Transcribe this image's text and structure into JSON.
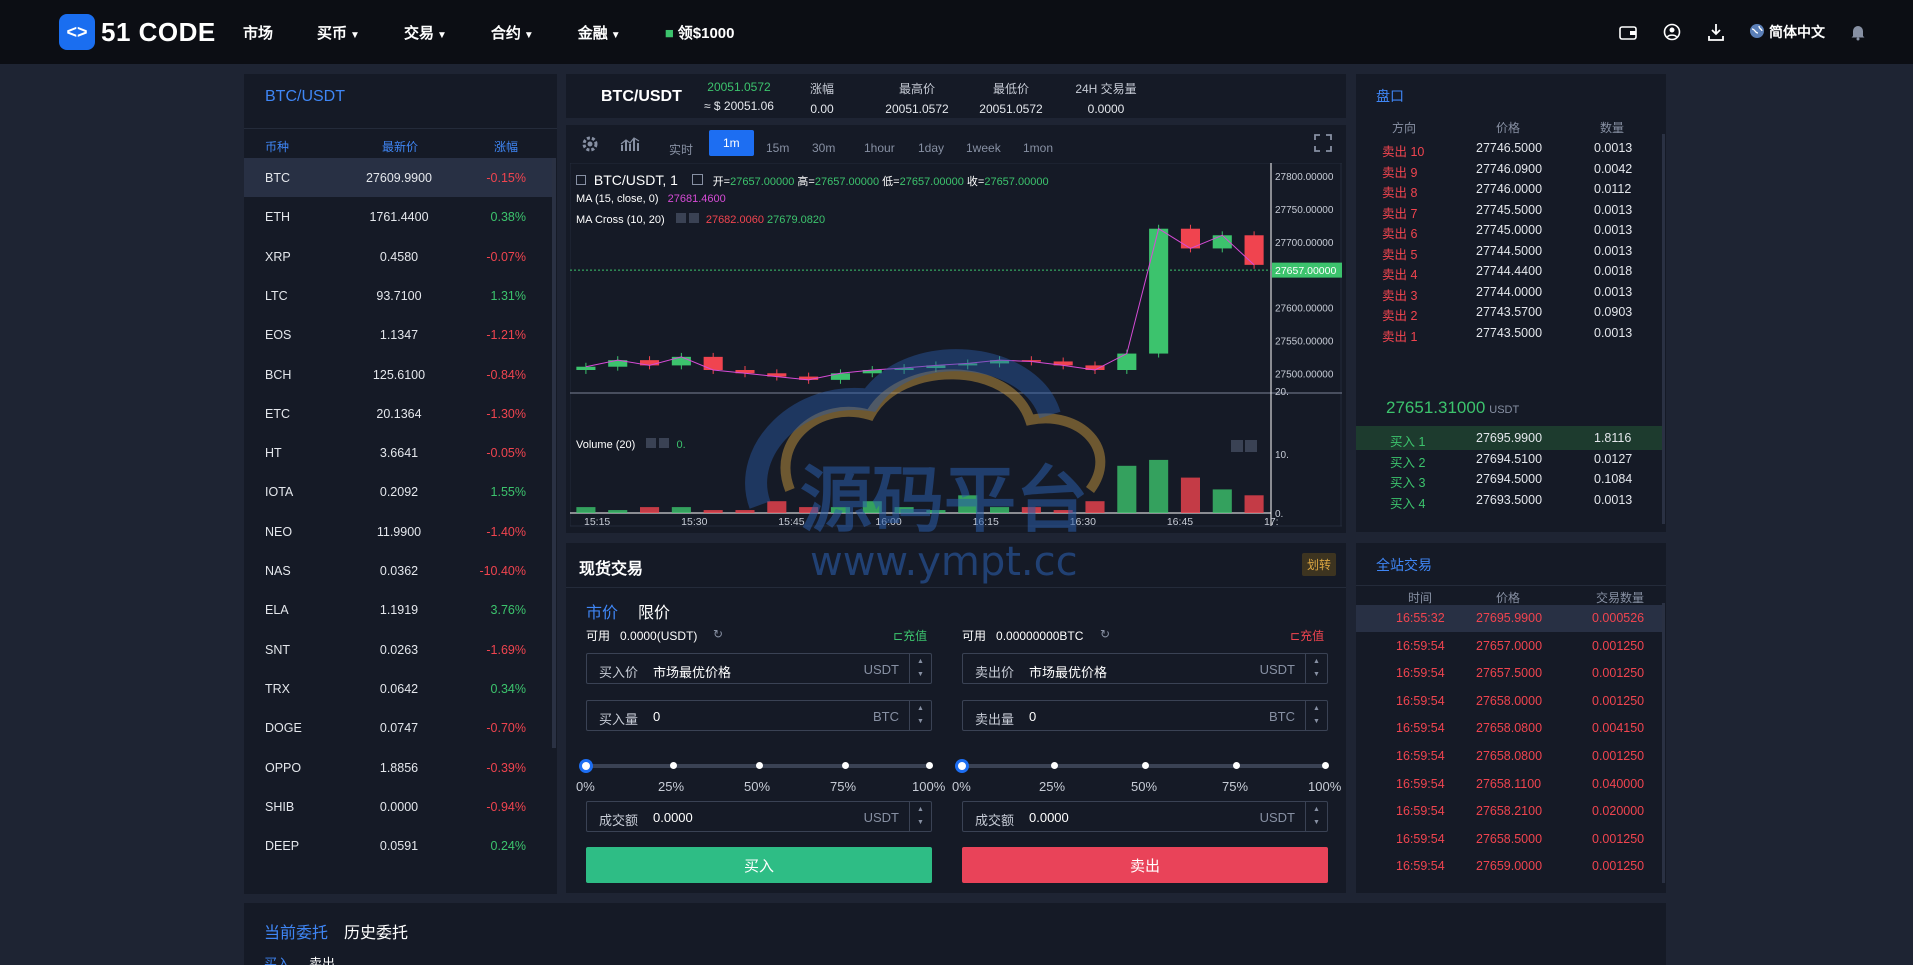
{
  "brand": {
    "logo_glyph": "<>",
    "name": "51 CODE"
  },
  "nav": [
    {
      "label": "市场",
      "dropdown": false
    },
    {
      "label": "买币",
      "dropdown": true
    },
    {
      "label": "交易",
      "dropdown": true
    },
    {
      "label": "合约",
      "dropdown": true
    },
    {
      "label": "金融",
      "dropdown": true
    },
    {
      "label": "领$1000",
      "dropdown": false
    }
  ],
  "top_right": {
    "language": "简体中文"
  },
  "market": {
    "title": "BTC/USDT",
    "headers": {
      "coin": "币种",
      "price": "最新价",
      "change": "涨幅"
    },
    "rows": [
      {
        "coin": "BTC",
        "price": "27609.9900",
        "change": "-0.15%"
      },
      {
        "coin": "ETH",
        "price": "1761.4400",
        "change": "0.38%"
      },
      {
        "coin": "XRP",
        "price": "0.4580",
        "change": "-0.07%"
      },
      {
        "coin": "LTC",
        "price": "93.7100",
        "change": "1.31%"
      },
      {
        "coin": "EOS",
        "price": "1.1347",
        "change": "-1.21%"
      },
      {
        "coin": "BCH",
        "price": "125.6100",
        "change": "-0.84%"
      },
      {
        "coin": "ETC",
        "price": "20.1364",
        "change": "-1.30%"
      },
      {
        "coin": "HT",
        "price": "3.6641",
        "change": "-0.05%"
      },
      {
        "coin": "IOTA",
        "price": "0.2092",
        "change": "1.55%"
      },
      {
        "coin": "NEO",
        "price": "11.9900",
        "change": "-1.40%"
      },
      {
        "coin": "NAS",
        "price": "0.0362",
        "change": "-10.40%"
      },
      {
        "coin": "ELA",
        "price": "1.1919",
        "change": "3.76%"
      },
      {
        "coin": "SNT",
        "price": "0.0263",
        "change": "-1.69%"
      },
      {
        "coin": "TRX",
        "price": "0.0642",
        "change": "0.34%"
      },
      {
        "coin": "DOGE",
        "price": "0.0747",
        "change": "-0.70%"
      },
      {
        "coin": "OPPO",
        "price": "1.8856",
        "change": "-0.39%"
      },
      {
        "coin": "SHIB",
        "price": "0.0000",
        "change": "-0.94%"
      },
      {
        "coin": "DEEP",
        "price": "0.0591",
        "change": "0.24%"
      }
    ]
  },
  "ticker": {
    "symbol": "BTC/USDT",
    "price": "20051.0572",
    "price_usd": "≈ $ 20051.06",
    "change_label": "涨幅",
    "change": "0.00",
    "high_label": "最高价",
    "high": "20051.0572",
    "low_label": "最低价",
    "low": "20051.0572",
    "volume_label": "24H 交易量",
    "volume": "0.0000"
  },
  "chart": {
    "timeframes": [
      "实时",
      "1m",
      "15m",
      "30m",
      "1hour",
      "1day",
      "1week",
      "1mon"
    ],
    "active_timeframe": "1m",
    "legend_symbol": "BTC/USDT, 1",
    "ohlc": {
      "o_label": "开=",
      "o": "27657.00000",
      "h_label": "高=",
      "h": "27657.00000",
      "l_label": "低=",
      "l": "27657.00000",
      "c_label": "收=",
      "c": "27657.00000"
    },
    "ma_label": "MA (15, close, 0)",
    "ma_value": "27681.4600",
    "cross_label": "MA Cross (10, 20)",
    "cross_v1": "27682.0060",
    "cross_v2": "27679.0820",
    "volume_label": "Volume (20)",
    "volume_value": "0.",
    "price_ticks": [
      "27800.00000",
      "27750.00000",
      "27700.00000",
      "27600.00000",
      "27550.00000",
      "27500.00000",
      "20."
    ],
    "current_price_tag": "27657.00000",
    "volume_ticks": [
      "10.",
      "0."
    ],
    "time_ticks": [
      "15:15",
      "15:30",
      "15:45",
      "16:00",
      "16:15",
      "16:30",
      "16:45",
      "17:"
    ]
  },
  "chart_data": {
    "type": "candlestick",
    "x": [
      "15:10",
      "15:15",
      "15:20",
      "15:25",
      "15:30",
      "15:35",
      "15:40",
      "15:45",
      "15:50",
      "15:55",
      "16:00",
      "16:05",
      "16:10",
      "16:15",
      "16:20",
      "16:25",
      "16:30",
      "16:35",
      "16:40",
      "16:45",
      "16:50",
      "16:55"
    ],
    "close": [
      27510,
      27520,
      27512,
      27525,
      27505,
      27500,
      27495,
      27490,
      27500,
      27505,
      27508,
      27512,
      27515,
      27520,
      27518,
      27512,
      27505,
      27530,
      27720,
      27690,
      27710,
      27665
    ],
    "ylim": [
      27470,
      27820
    ],
    "current": 27657,
    "volume": [
      1,
      0.5,
      1,
      1,
      0.5,
      0.5,
      2,
      1,
      1,
      2,
      1,
      0.5,
      3,
      1,
      1,
      0.5,
      2,
      8,
      9,
      6,
      4,
      3
    ],
    "volume_ylim": [
      0,
      20
    ]
  },
  "orderbook": {
    "title": "盘口",
    "headers": {
      "side": "方向",
      "price": "价格",
      "qty": "数量"
    },
    "asks": [
      {
        "side": "卖出 10",
        "price": "27746.5000",
        "qty": "0.0013"
      },
      {
        "side": "卖出 9",
        "price": "27746.0900",
        "qty": "0.0042"
      },
      {
        "side": "卖出 8",
        "price": "27746.0000",
        "qty": "0.0112"
      },
      {
        "side": "卖出 7",
        "price": "27745.5000",
        "qty": "0.0013"
      },
      {
        "side": "卖出 6",
        "price": "27745.0000",
        "qty": "0.0013"
      },
      {
        "side": "卖出 5",
        "price": "27744.5000",
        "qty": "0.0013"
      },
      {
        "side": "卖出 4",
        "price": "27744.4400",
        "qty": "0.0018"
      },
      {
        "side": "卖出 3",
        "price": "27744.0000",
        "qty": "0.0013"
      },
      {
        "side": "卖出 2",
        "price": "27743.5700",
        "qty": "0.0903"
      },
      {
        "side": "卖出 1",
        "price": "27743.5000",
        "qty": "0.0013"
      }
    ],
    "last_price": "27651.31000",
    "last_unit": "USDT",
    "bids": [
      {
        "side": "买入 1",
        "price": "27695.9900",
        "qty": "1.8116"
      },
      {
        "side": "买入 2",
        "price": "27694.5100",
        "qty": "0.0127"
      },
      {
        "side": "买入 3",
        "price": "27694.5000",
        "qty": "0.1084"
      },
      {
        "side": "买入 4",
        "price": "27693.5000",
        "qty": "0.0013"
      }
    ]
  },
  "spot": {
    "tab": "现货交易",
    "badge": "划转",
    "mode_market": "市价",
    "mode_limit": "限价",
    "buy": {
      "avail_label": "可用",
      "avail": "0.0000(USDT)",
      "recharge": "充值",
      "price_label": "买入价",
      "price_value": "市场最优价格",
      "price_unit": "USDT",
      "qty_label": "买入量",
      "qty_value": "0",
      "qty_unit": "BTC",
      "total_label": "成交额",
      "total_value": "0.0000",
      "total_unit": "USDT",
      "slider_value": 0,
      "button": "买入"
    },
    "sell": {
      "avail_label": "可用",
      "avail": "0.00000000BTC",
      "recharge": "充值",
      "price_label": "卖出价",
      "price_value": "市场最优价格",
      "price_unit": "USDT",
      "qty_label": "卖出量",
      "qty_value": "0",
      "qty_unit": "BTC",
      "total_label": "成交额",
      "total_value": "0.0000",
      "total_unit": "USDT",
      "slider_value": 0,
      "button": "卖出"
    },
    "slider_marks": [
      "0%",
      "25%",
      "50%",
      "75%",
      "100%"
    ]
  },
  "trades": {
    "title": "全站交易",
    "headers": {
      "time": "时间",
      "price": "价格",
      "qty": "交易数量"
    },
    "rows": [
      {
        "time": "16:55:32",
        "price": "27695.9900",
        "qty": "0.000526"
      },
      {
        "time": "16:59:54",
        "price": "27657.0000",
        "qty": "0.001250"
      },
      {
        "time": "16:59:54",
        "price": "27657.5000",
        "qty": "0.001250"
      },
      {
        "time": "16:59:54",
        "price": "27658.0000",
        "qty": "0.001250"
      },
      {
        "time": "16:59:54",
        "price": "27658.0800",
        "qty": "0.004150"
      },
      {
        "time": "16:59:54",
        "price": "27658.0800",
        "qty": "0.001250"
      },
      {
        "time": "16:59:54",
        "price": "27658.1100",
        "qty": "0.040000"
      },
      {
        "time": "16:59:54",
        "price": "27658.2100",
        "qty": "0.020000"
      },
      {
        "time": "16:59:54",
        "price": "27658.5000",
        "qty": "0.001250"
      },
      {
        "time": "16:59:54",
        "price": "27659.0000",
        "qty": "0.001250"
      }
    ]
  },
  "orders": {
    "tab_current": "当前委托",
    "tab_history": "历史委托",
    "sub_buy": "买入",
    "sub_sell": "卖出"
  },
  "watermark": {
    "text": "源码平台",
    "url": "www.ympt.cc"
  },
  "colors": {
    "up": "#3cc36d",
    "down": "#f0444f",
    "accent": "#1d6ef2"
  }
}
